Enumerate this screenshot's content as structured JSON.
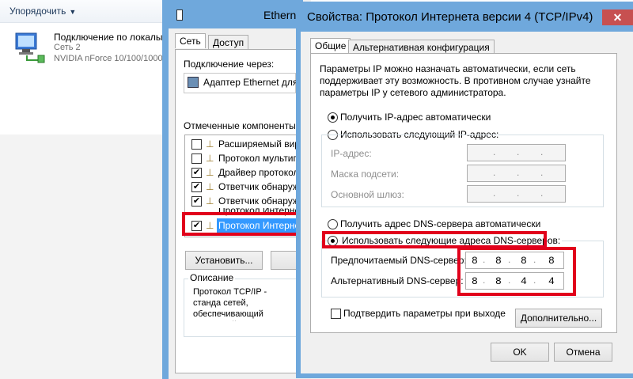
{
  "explorer": {
    "organize_label": "Упорядочить",
    "connection": {
      "name": "Подключение по локалы",
      "network": "Сеть  2",
      "adapter": "NVIDIA nForce 10/100/1000"
    }
  },
  "ethernet": {
    "title": "Ethernet",
    "tabs": [
      "Сеть",
      "Доступ"
    ],
    "connect_using_label": "Подключение через:",
    "adapter_name": "Адаптер Ethernet для",
    "components_label": "Отмеченные компоненты и",
    "components": [
      {
        "label": "Расширяемый вирт",
        "checked": false
      },
      {
        "label": "Протокол мультипл",
        "checked": false
      },
      {
        "label": "Драйвер протокола",
        "checked": true
      },
      {
        "label": "Ответчик обнаруже",
        "checked": true
      },
      {
        "label": "Ответчик обнаруже",
        "checked": true
      },
      {
        "label": "Протокол Интернет",
        "checked": true
      },
      {
        "label": "Протокол Интернет",
        "checked": true,
        "selected": true
      }
    ],
    "install_button": "Установить...",
    "description_group": "Описание",
    "description_text": "Протокол TCP/IP - станда сетей, обеспечивающий взаимодействующими"
  },
  "ipv4": {
    "title": "Свойства: Протокол Интернета версии 4 (TCP/IPv4)",
    "close_label": "✕",
    "tabs": [
      "Общие",
      "Альтернативная конфигурация"
    ],
    "intro": "Параметры IP можно назначать автоматически, если сеть поддерживает эту возможность. В противном случае узнайте параметры IP у сетевого администратора.",
    "ip_auto": "Получить IP-адрес автоматически",
    "ip_manual": "Использовать следующий IP-адрес:",
    "ip_address_label": "IP-адрес:",
    "subnet_label": "Маска подсети:",
    "gateway_label": "Основной шлюз:",
    "dns_auto": "Получить адрес DNS-сервера автоматически",
    "dns_manual": "Использовать следующие адреса DNS-серверов:",
    "preferred_dns_label": "Предпочитаемый DNS-сервер:",
    "alternate_dns_label": "Альтернативный DNS-сервер:",
    "preferred_dns": [
      "8",
      "8",
      "8",
      "8"
    ],
    "alternate_dns": [
      "8",
      "8",
      "4",
      "4"
    ],
    "validate_label": "Подтвердить параметры при выходе",
    "advanced_button": "Дополнительно...",
    "ok_button": "OK",
    "cancel_button": "Отмена"
  }
}
